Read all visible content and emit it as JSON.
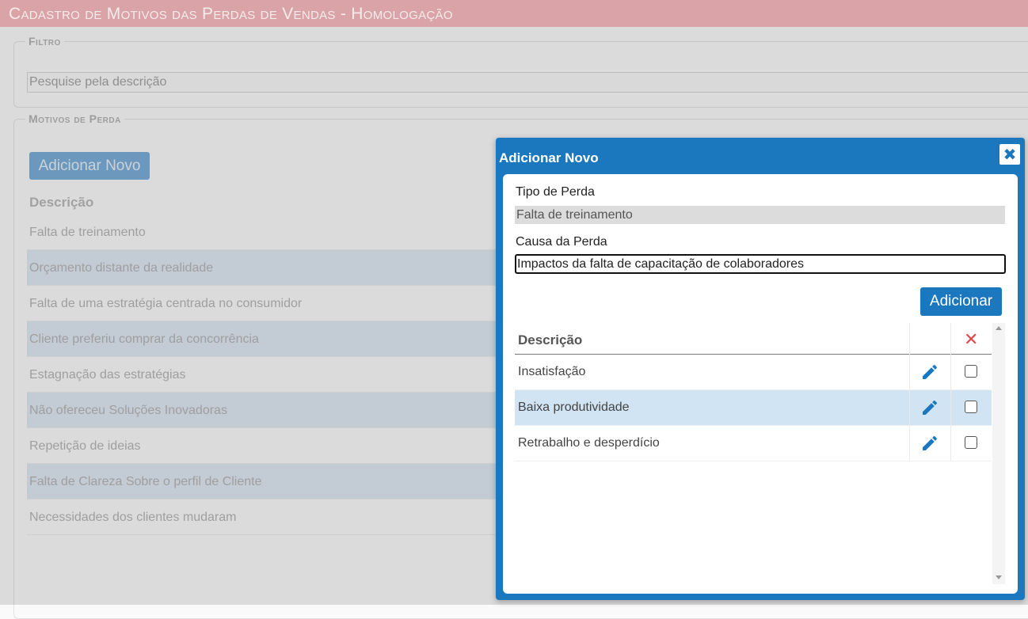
{
  "app": {
    "title": "Cadastro de Motivos das Perdas de Vendas  - Homologação"
  },
  "filter": {
    "legend": "Filtro",
    "search_placeholder": "Pesquise pela descrição"
  },
  "motivos": {
    "legend": "Motivos de Perda",
    "add_new_label": "Adicionar Novo",
    "column_header": "Descrição",
    "rows": [
      "Falta de treinamento",
      "Orçamento distante da realidade",
      "Falta de uma estratégia centrada no consumidor",
      "Cliente preferiu comprar da concorrência",
      "Estagnação das estratégias",
      "Não ofereceu Soluções Inovadoras",
      "Repetição de ideias",
      "Falta de Clareza Sobre o perfil de Cliente",
      "Necessidades dos clientes mudaram"
    ]
  },
  "modal": {
    "title": "Adicionar Novo",
    "close_glyph": "✖",
    "tipo_label": "Tipo de Perda",
    "tipo_value": "Falta de treinamento",
    "causa_label": "Causa da Perda",
    "causa_value": "Impactos da falta de capacitação de colaboradores",
    "add_button_label": "Adicionar",
    "table": {
      "header_descricao": "Descrição",
      "delete_all_glyph": "✕",
      "rows": [
        {
          "descricao": "Insatisfação",
          "checked": false
        },
        {
          "descricao": "Baixa produtividade",
          "checked": false,
          "selected": true
        },
        {
          "descricao": "Retrabalho e desperdício",
          "checked": false
        }
      ]
    }
  },
  "colors": {
    "title_bar": "#d9a3a7",
    "modal_primary": "#1b78bf",
    "delete_red": "#e04848",
    "selected_row": "#d1e4f4"
  },
  "icons": {
    "edit": "pencil-icon",
    "delete": "close-x-icon",
    "checkbox": "checkbox-icon"
  }
}
